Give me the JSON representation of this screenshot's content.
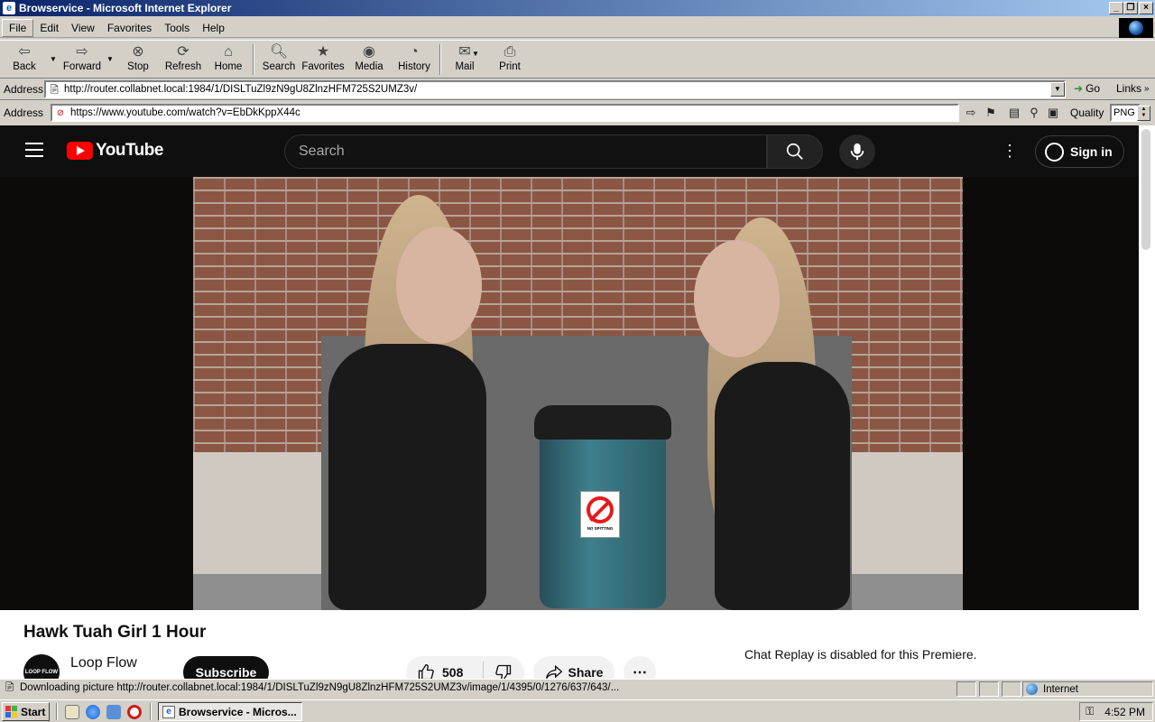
{
  "window": {
    "title": "Browservice - Microsoft Internet Explorer"
  },
  "menu": [
    "File",
    "Edit",
    "View",
    "Favorites",
    "Tools",
    "Help"
  ],
  "toolbar": {
    "back": "Back",
    "forward": "Forward",
    "stop": "Stop",
    "refresh": "Refresh",
    "home": "Home",
    "search": "Search",
    "favorites": "Favorites",
    "media": "Media",
    "history": "History",
    "mail": "Mail",
    "print": "Print"
  },
  "address_bar": {
    "label": "Address",
    "url": "http://router.collabnet.local:1984/1/DISLTuZl9zN9gU8ZlnzHFM725S2UMZ3v/",
    "go": "Go",
    "links": "Links"
  },
  "browservice_bar": {
    "label": "Address",
    "url": "https://www.youtube.com/watch?v=EbDkKppX44c",
    "quality_label": "Quality",
    "quality_value": "PNG"
  },
  "youtube": {
    "logo_text": "YouTube",
    "search_placeholder": "Search",
    "sign_in": "Sign in",
    "video": {
      "sign_text": "NO SPITTING"
    },
    "title": "Hawk Tuah Girl 1 Hour",
    "channel": {
      "name": "Loop Flow",
      "avatar_text": "LOOP FLOW"
    },
    "subscribe": "Subscribe",
    "likes": "508",
    "share": "Share",
    "more": "⋯",
    "chat_replay": "Chat Replay is disabled for this Premiere."
  },
  "status_bar": {
    "text": "Downloading picture http://router.collabnet.local:1984/1/DISLTuZl9zN9gU8ZlnzHFM725S2UMZ3v/image/1/4395/0/1276/637/643/...",
    "zone": "Internet"
  },
  "taskbar": {
    "start": "Start",
    "task": "Browservice - Micros...",
    "clock": "4:52 PM"
  },
  "colors": {
    "title_gradient_start": "#0a246a",
    "title_gradient_end": "#a6caf0",
    "youtube_red": "#ff0000",
    "youtube_dark": "#0f0f0f"
  }
}
